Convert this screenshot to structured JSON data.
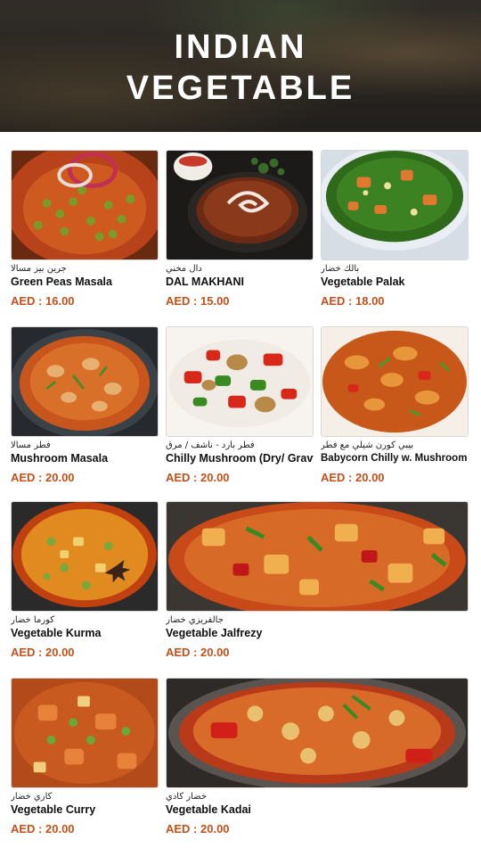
{
  "header": {
    "line1": "INDIAN",
    "line2": "VEGETABLE"
  },
  "colors": {
    "price": "#c4501a",
    "title": "#ffffff"
  },
  "items": [
    {
      "ar": "جرين بيز مسالا",
      "en": "Green Peas Masala",
      "price": "AED : 16.00"
    },
    {
      "ar": "دال مخني",
      "en": "DAL MAKHANI",
      "price": "AED : 15.00"
    },
    {
      "ar": "بالك خضار",
      "en": "Vegetable Palak",
      "price": "AED : 18.00"
    },
    {
      "ar": "فطر مسالا",
      "en": "Mushroom Masala",
      "price": "AED : 20.00"
    },
    {
      "ar": "فطر بارد - ناشف / مرق",
      "en": "Chilly Mushroom (Dry/ Gravy",
      "price": "AED : 20.00"
    },
    {
      "ar": "بيبي كورن شيلي مع فطر",
      "en": "Babycorn Chilly w. Mushroom",
      "price": "AED : 20.00"
    },
    {
      "ar": "كورما خضار",
      "en": "Vegetable Kurma",
      "price": "AED : 20.00"
    },
    {
      "ar": "جالفريزي خضار",
      "en": "Vegetable Jalfrezy",
      "price": "AED : 20.00"
    },
    {
      "ar": "كاري خضار",
      "en": "Vegetable Curry",
      "price": "AED : 20.00"
    },
    {
      "ar": "خضار كادي",
      "en": "Vegetable Kadai",
      "price": "AED : 20.00"
    }
  ]
}
